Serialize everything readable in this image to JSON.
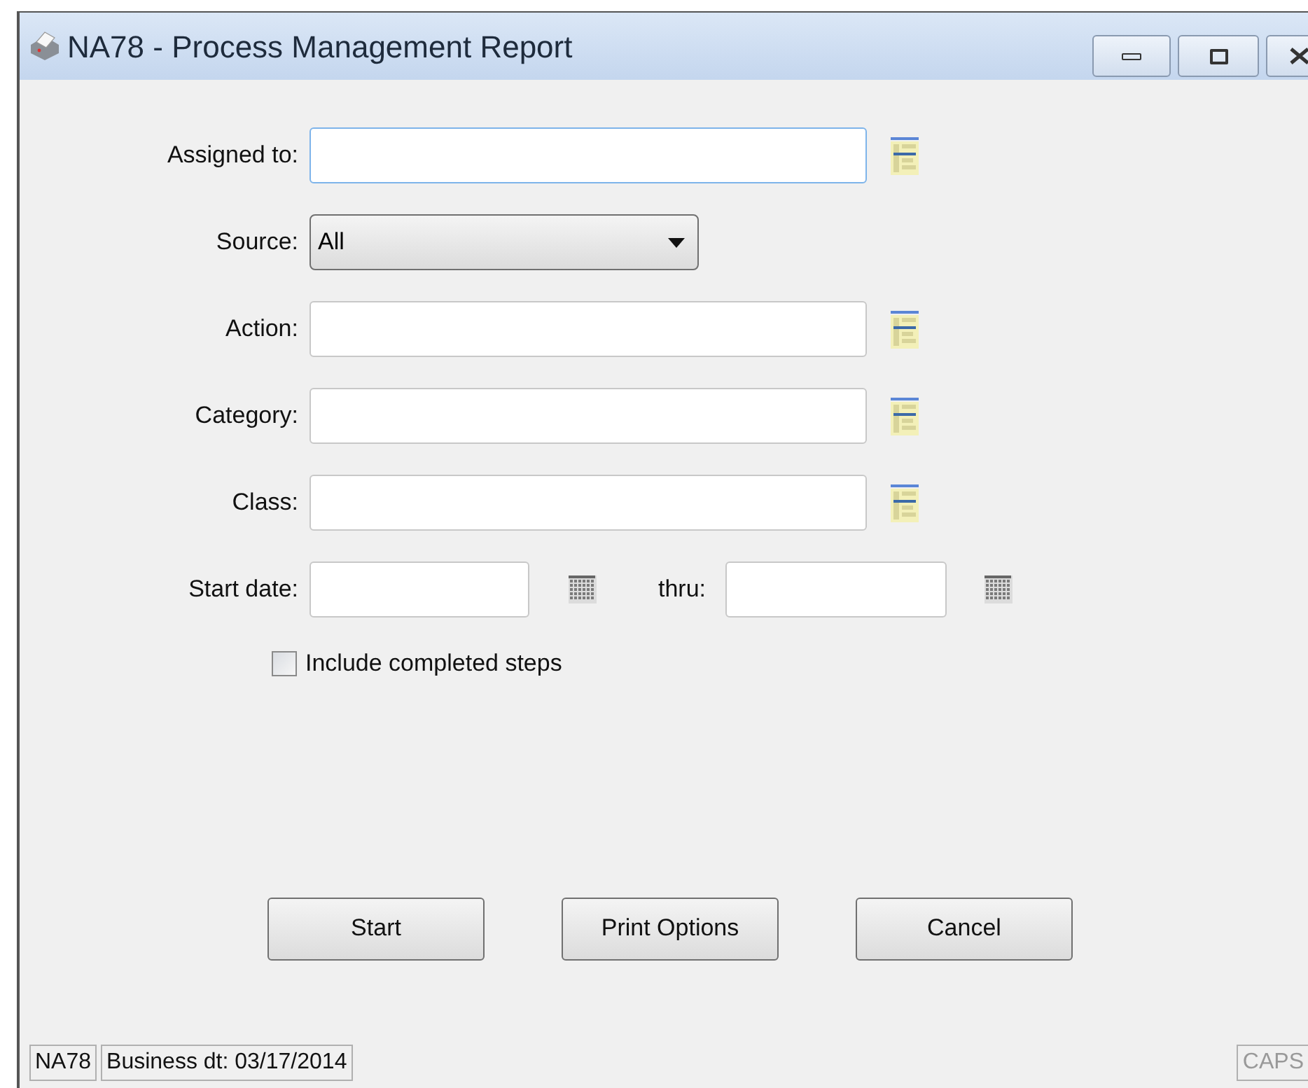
{
  "window": {
    "title": "NA78 - Process Management Report"
  },
  "fields": [
    {
      "kind": "lookup",
      "label": "Assigned to:",
      "focused": true
    },
    {
      "kind": "dropdown",
      "label": "Source:",
      "value": "All"
    },
    {
      "kind": "lookup",
      "label": "Action:",
      "focused": false
    },
    {
      "kind": "lookup",
      "label": "Category:",
      "focused": false
    },
    {
      "kind": "lookup",
      "label": "Class:",
      "focused": false
    },
    {
      "kind": "daterange",
      "label": "Start date:",
      "thru_label": "thru:"
    }
  ],
  "checkbox": {
    "label": "Include completed steps",
    "checked": false
  },
  "buttons": [
    "Start",
    "Print Options",
    "Cancel"
  ],
  "status_bar": [
    "NA78",
    "Business dt: 03/17/2014",
    "CAPS"
  ]
}
